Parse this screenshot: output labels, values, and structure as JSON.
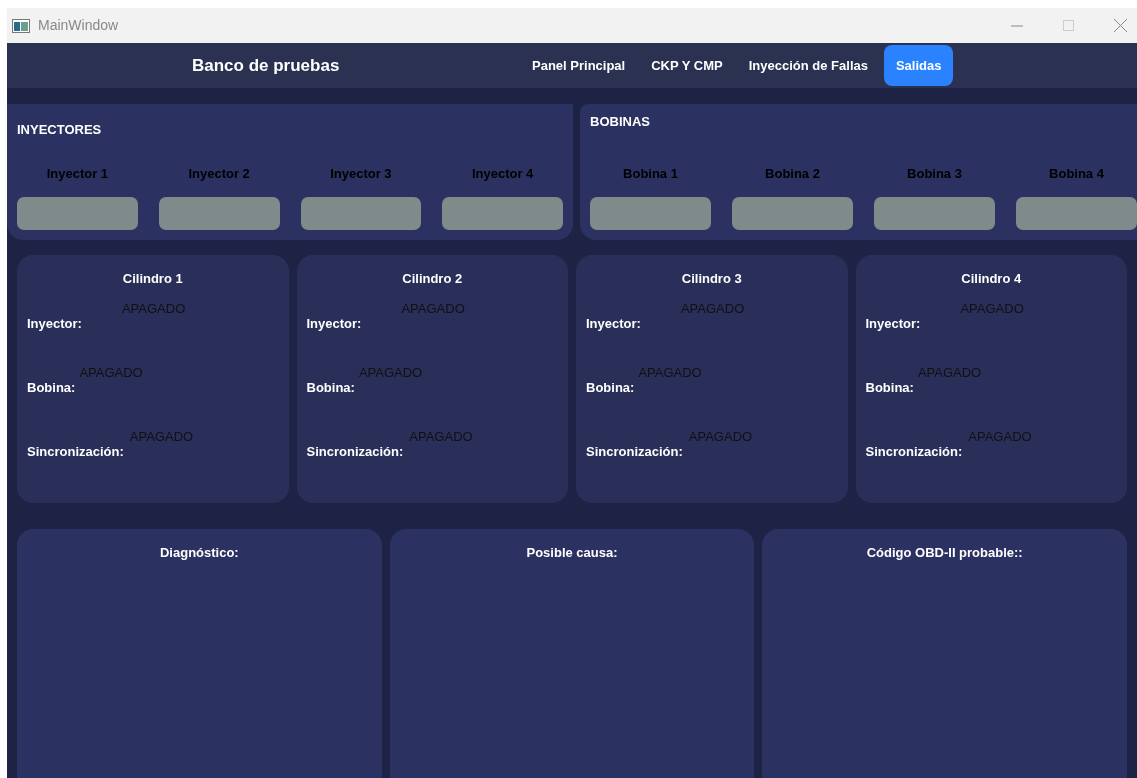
{
  "window": {
    "title": "MainWindow"
  },
  "header": {
    "title": "Banco de pruebas"
  },
  "tabs": [
    {
      "label": "Panel Principal",
      "selected": false
    },
    {
      "label": "CKP Y CMP",
      "selected": false
    },
    {
      "label": "Inyección de Fallas",
      "selected": false
    },
    {
      "label": "Salidas",
      "selected": true
    }
  ],
  "injectors": {
    "title": "INYECTORES",
    "items": [
      "Inyector 1",
      "Inyector 2",
      "Inyector 3",
      "Inyector 4"
    ]
  },
  "coils": {
    "title": "BOBINAS",
    "items": [
      "Bobina 1",
      "Bobina 2",
      "Bobina 3",
      "Bobina 4"
    ]
  },
  "cylinders": [
    {
      "title": "Cilindro 1",
      "rows": [
        {
          "label": "Inyector:",
          "value": "APAGADO"
        },
        {
          "label": "Bobina:",
          "value": "APAGADO"
        },
        {
          "label": "Sincronización:",
          "value": "APAGADO"
        }
      ]
    },
    {
      "title": "Cilindro 2",
      "rows": [
        {
          "label": "Inyector:",
          "value": "APAGADO"
        },
        {
          "label": "Bobina:",
          "value": "APAGADO"
        },
        {
          "label": "Sincronización:",
          "value": "APAGADO"
        }
      ]
    },
    {
      "title": "Cilindro 3",
      "rows": [
        {
          "label": "Inyector:",
          "value": "APAGADO"
        },
        {
          "label": "Bobina:",
          "value": "APAGADO"
        },
        {
          "label": "Sincronización:",
          "value": "APAGADO"
        }
      ]
    },
    {
      "title": "Cilindro 4",
      "rows": [
        {
          "label": "Inyector:",
          "value": "APAGADO"
        },
        {
          "label": "Bobina:",
          "value": "APAGADO"
        },
        {
          "label": "Sincronización:",
          "value": "APAGADO"
        }
      ]
    }
  ],
  "results": [
    {
      "title": "Diagnóstico:"
    },
    {
      "title": "Posible causa:"
    },
    {
      "title": "Código OBD-II probable::"
    }
  ]
}
